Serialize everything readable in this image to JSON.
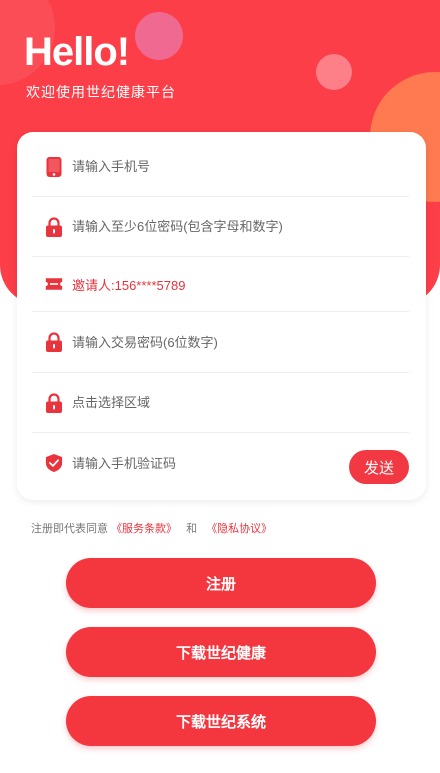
{
  "header": {
    "greeting": "Hello!",
    "welcome": "欢迎使用世纪健康平台"
  },
  "form": {
    "phone_placeholder": "请输入手机号",
    "password_placeholder": "请输入至少6位密码(包含字母和数字)",
    "inviter_text": "邀请人:156****5789",
    "trade_password_placeholder": "请输入交易密码(6位数字)",
    "region_placeholder": "点击选择区域",
    "sms_code_placeholder": "请输入手机验证码",
    "send_label": "发送"
  },
  "agreement": {
    "prefix": "注册即代表同意",
    "terms": "《服务条款》",
    "and": "和",
    "privacy": "《隐私协议》"
  },
  "buttons": {
    "register": "注册",
    "download_health": "下载世纪健康",
    "download_system": "下载世纪系统"
  },
  "colors": {
    "brand": "#fb3e48",
    "accent_orange": "#ff7a50"
  },
  "icons": {
    "phone": "phone-icon",
    "lock": "lock-icon",
    "ticket": "ticket-icon",
    "shield": "shield-check-icon"
  }
}
